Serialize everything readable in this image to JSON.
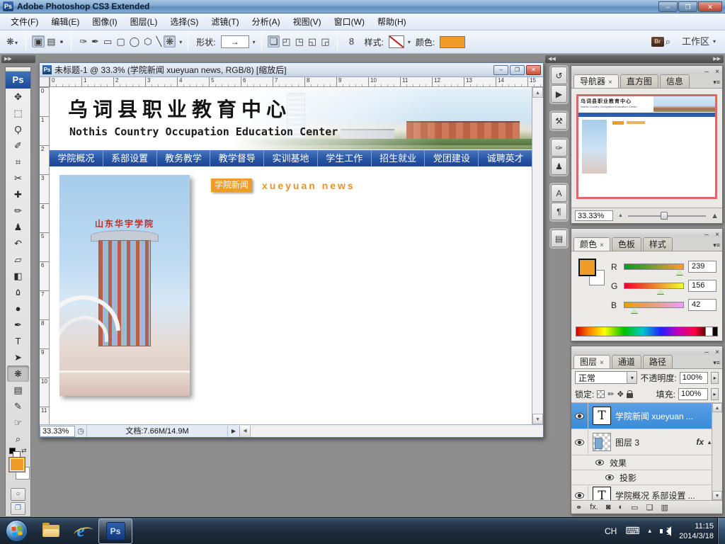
{
  "window": {
    "title": "Adobe Photoshop CS3 Extended",
    "app_icon": "Ps"
  },
  "icons": {
    "minimize": "–",
    "restore": "❐",
    "close": "✕",
    "doc_minimize": "–",
    "doc_restore": "❐",
    "doc_close": "✕",
    "panel_minimize": "–",
    "panel_close": "×",
    "tab_close": "×",
    "panel_menu": "▾≡",
    "dropdown": "▾",
    "spinner": "▸",
    "scroll_up": "▲",
    "scroll_down": "▼",
    "scroll_left": "◀",
    "status_arrow": "▶",
    "collapse_left": "▶▶",
    "collapse_right_a": "◀◀",
    "collapse_right_b": "▶▶",
    "clock_status": "◷",
    "link_chain": "8",
    "swap_colors": "⇄",
    "quick_mask": "○",
    "screen_mode": "❐",
    "zoom_out_mountain": "▲",
    "zoom_in_mountain": "▲",
    "keyboard_tray": "⌨",
    "tray_chevron": "▴",
    "bridge_logo": "Br",
    "bridge_zoom": "⌕",
    "fx_caret_up": "▲",
    "fx_caret_down": "▼"
  },
  "menu": {
    "items": [
      "文件(F)",
      "编辑(E)",
      "图像(I)",
      "图层(L)",
      "选择(S)",
      "滤镜(T)",
      "分析(A)",
      "视图(V)",
      "窗口(W)",
      "帮助(H)"
    ]
  },
  "options_bar": {
    "preset_tool": {
      "name": "custom-shape-preset",
      "glyph": "❋"
    },
    "mode_buttons": [
      {
        "name": "shape-layers-mode",
        "glyph": "▣",
        "state": "selected"
      },
      {
        "name": "paths-mode",
        "glyph": "▤"
      },
      {
        "name": "fill-pixels-mode",
        "glyph": "▪"
      }
    ],
    "draw_tools": [
      {
        "name": "pen-option",
        "glyph": "✑"
      },
      {
        "name": "freeform-pen-option",
        "glyph": "✒"
      },
      {
        "name": "rectangle-option",
        "glyph": "▭"
      },
      {
        "name": "rounded-rectangle-option",
        "glyph": "▢"
      },
      {
        "name": "ellipse-option",
        "glyph": "◯"
      },
      {
        "name": "polygon-option",
        "glyph": "⬡"
      },
      {
        "name": "line-option",
        "glyph": "╲"
      },
      {
        "name": "custom-shape-option",
        "glyph": "❋",
        "state": "selected"
      }
    ],
    "shape_label": "形状:",
    "shape_preview_glyph": "→",
    "combine_buttons": [
      {
        "name": "add-shape-area",
        "glyph": "❏",
        "state": "selected"
      },
      {
        "name": "subtract-shape-area",
        "glyph": "◰"
      },
      {
        "name": "intersect-shape-area",
        "glyph": "◳"
      },
      {
        "name": "exclude-shape-area",
        "glyph": "◱"
      },
      {
        "name": "overlap-shape-area",
        "glyph": "◲"
      }
    ],
    "style_label": "样式:",
    "color_label": "颜色:",
    "workspace_label": "工作区"
  },
  "toolbar": {
    "logo": "Ps",
    "tools": [
      {
        "name": "move-tool",
        "glyph": "✥"
      },
      {
        "name": "marquee-tool",
        "glyph": "⬚"
      },
      {
        "name": "lasso-tool",
        "glyph": "Ϙ"
      },
      {
        "name": "quick-selection-tool",
        "glyph": "✐"
      },
      {
        "name": "crop-tool",
        "glyph": "⌗"
      },
      {
        "name": "slice-tool",
        "glyph": "✂"
      },
      {
        "name": "healing-brush-tool",
        "glyph": "✚"
      },
      {
        "name": "brush-tool",
        "glyph": "✏"
      },
      {
        "name": "clone-stamp-tool",
        "glyph": "♟"
      },
      {
        "name": "history-brush-tool",
        "glyph": "↶"
      },
      {
        "name": "eraser-tool",
        "glyph": "▱"
      },
      {
        "name": "gradient-tool",
        "glyph": "◧"
      },
      {
        "name": "blur-tool",
        "glyph": "۵"
      },
      {
        "name": "dodge-tool",
        "glyph": "●"
      },
      {
        "name": "pen-tool",
        "glyph": "✒"
      },
      {
        "name": "type-tool",
        "glyph": "T"
      },
      {
        "name": "path-selection-tool",
        "glyph": "➤"
      },
      {
        "name": "custom-shape-tool",
        "glyph": "❋",
        "state": "selected"
      },
      {
        "name": "notes-tool",
        "glyph": "▤"
      },
      {
        "name": "eyedropper-tool",
        "glyph": "✎"
      },
      {
        "name": "hand-tool",
        "glyph": "☞"
      },
      {
        "name": "zoom-tool",
        "glyph": "⌕"
      }
    ],
    "foreground_color": "#EF9C2A",
    "background_color": "#FFFFFF"
  },
  "document": {
    "title": "未标题-1 @ 33.3% (学院新闻 xueyuan news, RGB/8) [缩放后]",
    "doc_icon": "Ps",
    "ruler_h": [
      "0",
      "1",
      "2",
      "3",
      "4",
      "5",
      "6",
      "7",
      "8",
      "9",
      "10",
      "11",
      "12",
      "13",
      "14",
      "15"
    ],
    "ruler_v": [
      "0",
      "1",
      "2",
      "3",
      "4",
      "5",
      "6",
      "7",
      "8",
      "9",
      "10",
      "11"
    ],
    "status": {
      "zoom": "33.33%",
      "doc_size": "文档:7.66M/14.9M"
    }
  },
  "canvas": {
    "site_title": "乌词县职业教育中心",
    "site_subtitle": "Nothis Country Occupation Education Center",
    "nav_items": [
      "学院概况",
      "系部设置",
      "教务教学",
      "教学督导",
      "实训基地",
      "学生工作",
      "招生就业",
      "党团建设",
      "诚聘英才"
    ],
    "news_badge": "学院新闻",
    "news_latin": "xueyuan news",
    "building_sign": "山东华宇学院"
  },
  "dock_strip": {
    "groups": [
      {
        "icons": [
          {
            "name": "history-panel-icon",
            "glyph": "↺"
          },
          {
            "name": "actions-panel-icon",
            "glyph": "▶"
          }
        ]
      },
      {
        "icons": [
          {
            "name": "tool-presets-panel-icon",
            "glyph": "⚒"
          }
        ]
      },
      {
        "icons": [
          {
            "name": "brushes-panel-icon",
            "glyph": "✑"
          },
          {
            "name": "clone-source-panel-icon",
            "glyph": "♟"
          }
        ]
      },
      {
        "icons": [
          {
            "name": "character-panel-icon",
            "glyph": "A"
          },
          {
            "name": "paragraph-panel-icon",
            "glyph": "¶"
          }
        ]
      },
      {
        "icons": [
          {
            "name": "layer-comps-panel-icon",
            "glyph": "▤"
          }
        ]
      }
    ]
  },
  "navigator": {
    "tabs": {
      "active": "导航器",
      "tab2": "直方图",
      "tab3": "信息"
    },
    "zoom": "33.33%"
  },
  "color_panel": {
    "tabs": {
      "active": "颜色",
      "tab2": "色板",
      "tab3": "样式"
    },
    "foreground": "#EF9C2A",
    "channels": [
      {
        "label": "R",
        "value": 239
      },
      {
        "label": "G",
        "value": 156
      },
      {
        "label": "B",
        "value": 42
      }
    ]
  },
  "layers_panel": {
    "tabs": {
      "active": "图层",
      "tab2": "通道",
      "tab3": "路径"
    },
    "blend_mode": "正常",
    "opacity_label": "不透明度:",
    "opacity_value": "100%",
    "lock_label": "锁定:",
    "fill_label": "填充:",
    "fill_value": "100%",
    "lock_icons": {
      "brush": "✏",
      "move": "✥"
    },
    "layers": [
      {
        "name": "学院新闻 xueyuan ...",
        "thumb": "T",
        "selected": true
      },
      {
        "name": "图层 3",
        "fx": "fx"
      },
      {
        "name": "效果"
      },
      {
        "name": "投影"
      },
      {
        "name": "学院概况 系部设置 ...",
        "thumb": "T"
      }
    ],
    "bottom_icons": [
      {
        "name": "link-layers-icon",
        "glyph": "⚭"
      },
      {
        "name": "layer-style-icon",
        "glyph": "fx."
      },
      {
        "name": "layer-mask-icon",
        "glyph": "◙"
      },
      {
        "name": "adjustment-layer-icon",
        "glyph": "◐"
      },
      {
        "name": "layer-group-icon",
        "glyph": "▭"
      },
      {
        "name": "new-layer-icon",
        "glyph": "❏"
      },
      {
        "name": "delete-layer-icon",
        "glyph": "▥"
      }
    ]
  },
  "taskbar": {
    "ps_button_label": "Ps",
    "tray": {
      "lang": "CH",
      "time": "11:15",
      "date": "2014/3/18"
    }
  },
  "colors": {
    "accent_orange": "#EF9C2A",
    "site_nav_blue": "#2B5DAE",
    "selected_layer_blue": "#4D9BE0"
  }
}
